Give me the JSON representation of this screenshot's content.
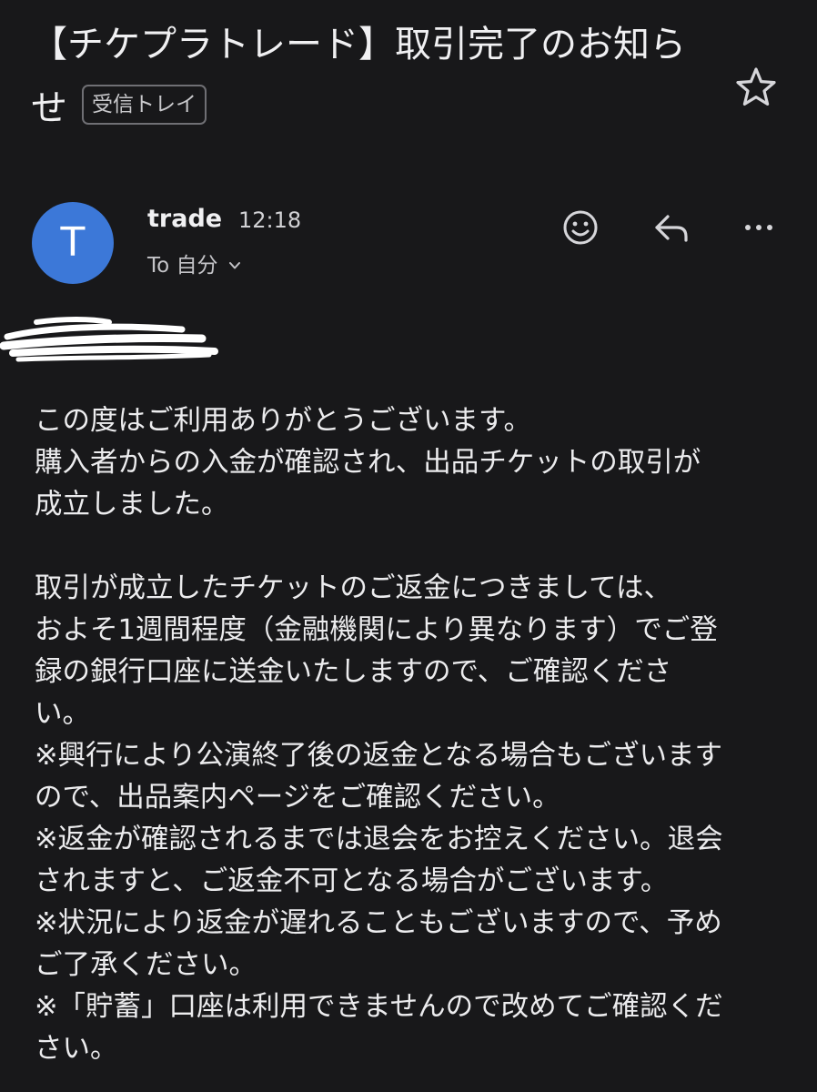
{
  "email": {
    "subject_line1": "【チケプラトレード】取引完了のお知ら",
    "subject_line2": "せ",
    "label": "受信トレイ",
    "sender_initial": "T",
    "sender_name": "trade",
    "time": "12:18",
    "recipient": "To 自分",
    "body": "この度はご利用ありがとうございます。\n購入者からの入金が確認され、出品チケットの取引が\n成立しました。\n\n取引が成立したチケットのご返金につきましては、\nおよそ1週間程度（金融機関により異なります）でご登\n録の銀行口座に送金いたしますので、ご確認くださ\nい。\n※興行により公演終了後の返金となる場合もございます\nので、出品案内ページをご確認ください。\n※返金が確認されるまでは退会をお控えください。退会\nされますと、ご返金不可となる場合がございます。\n※状況により返金が遅れることもございますので、予め\nご了承ください。\n※「貯蓄」口座は利用できませんので改めてご確認くだ\nさい。"
  },
  "icons": {
    "star": "star-icon",
    "emoji": "emoji-reaction-icon",
    "reply": "reply-icon",
    "more": "more-options-icon",
    "chevron": "chevron-down-icon"
  },
  "colors": {
    "background": "#18181a",
    "avatar": "#3c78d8",
    "text": "#ececee"
  }
}
